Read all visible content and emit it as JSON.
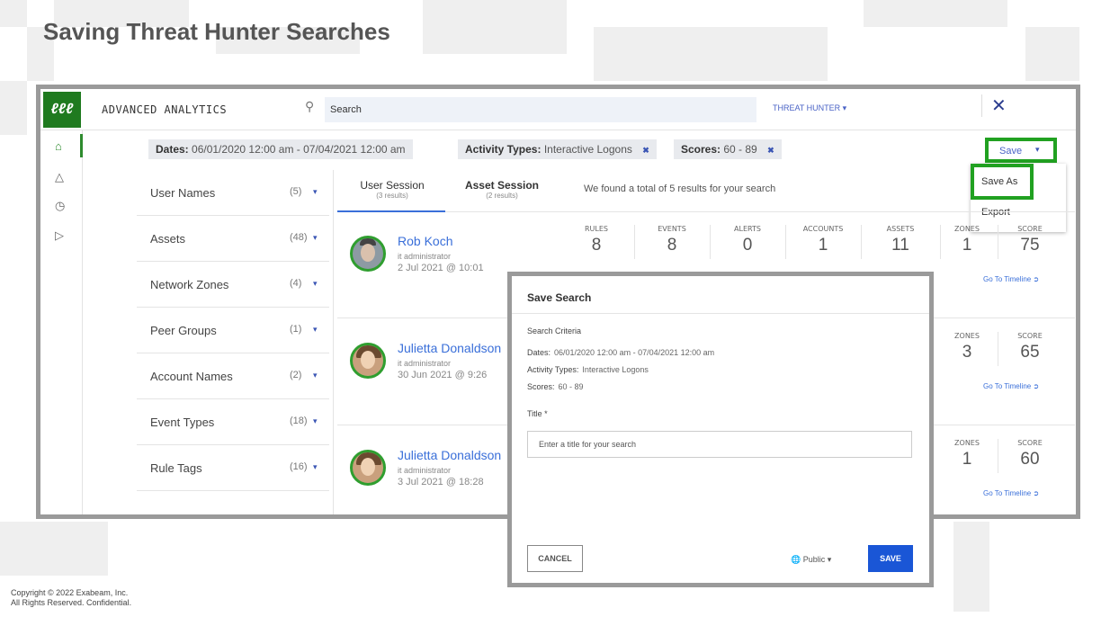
{
  "slide": {
    "title": "Saving Threat Hunter Searches",
    "copyright_line1": "Copyright © 2022 Exabeam, Inc.",
    "copyright_line2": "All Rights Reserved. Confidential."
  },
  "topbar": {
    "logo_text": "ℓℓℓ",
    "app_title": "ADVANCED ANALYTICS",
    "search_placeholder": "Search",
    "threat_hunter_label": "THREAT HUNTER ▾",
    "close_glyph": "✕"
  },
  "sidenav": {
    "icons": [
      "home-icon",
      "alert-triangle-icon",
      "clock-icon",
      "play-icon"
    ],
    "glyphs": [
      "⌂",
      "△",
      "◷",
      "▷"
    ]
  },
  "filters": {
    "dates_label": "Dates:",
    "dates_value": "06/01/2020 12:00 am - 07/04/2021 12:00 am",
    "activity_label": "Activity Types:",
    "activity_value": "Interactive Logons",
    "scores_label": "Scores:",
    "scores_value": "60 - 89",
    "remove_glyph": "✖"
  },
  "save_menu": {
    "save_label": "Save",
    "caret": "▾",
    "save_as_label": "Save As",
    "export_label": "Export"
  },
  "facets": [
    {
      "label": "User Names",
      "count": "(5)"
    },
    {
      "label": "Assets",
      "count": "(48)"
    },
    {
      "label": "Network Zones",
      "count": "(4)"
    },
    {
      "label": "Peer Groups",
      "count": "(1)"
    },
    {
      "label": "Account Names",
      "count": "(2)"
    },
    {
      "label": "Event Types",
      "count": "(18)"
    },
    {
      "label": "Rule Tags",
      "count": "(16)"
    }
  ],
  "facet_caret": "▾",
  "tabs": [
    {
      "label": "User Session",
      "sub": "(3 results)"
    },
    {
      "label": "Asset Session",
      "sub": "(2 results)"
    }
  ],
  "results_summary": "We found a total of 5 results for your search",
  "stat_labels": {
    "rules": "RULES",
    "events": "EVENTS",
    "alerts": "ALERTS",
    "accounts": "ACCOUNTS",
    "assets": "ASSETS",
    "zones": "ZONES",
    "score": "SCORE"
  },
  "goto_label": "Go To Timeline ➲",
  "results": [
    {
      "name": "Rob Koch",
      "role": "it administrator",
      "date": "2 Jul 2021 @ 10:01",
      "rules": "8",
      "events": "8",
      "alerts": "0",
      "accounts": "1",
      "assets": "11",
      "zones": "1",
      "score": "75"
    },
    {
      "name": "Julietta Donaldson",
      "role": "it administrator",
      "date": "30 Jun 2021 @ 9:26",
      "zones": "3",
      "score": "65"
    },
    {
      "name": "Julietta Donaldson",
      "role": "it administrator",
      "date": "3 Jul 2021 @ 18:28",
      "zones": "1",
      "score": "60"
    }
  ],
  "modal": {
    "title": "Save Search",
    "criteria_heading": "Search Criteria",
    "dates_label": "Dates:",
    "dates_value": "06/01/2020 12:00 am - 07/04/2021 12:00 am",
    "activity_label": "Activity Types:",
    "activity_value": "Interactive Logons",
    "scores_label": "Scores:",
    "scores_value": "60 - 89",
    "title_field_label": "Title *",
    "title_placeholder": "Enter a title for your search",
    "cancel_label": "CANCEL",
    "visibility_label": "🌐 Public ▾",
    "save_label": "SAVE"
  },
  "colors": {
    "brand_green": "#1f7a1f",
    "highlight_green": "#21a121",
    "link_blue": "#3a6fd9",
    "save_blue": "#1a56d6",
    "frame_gray": "#9a9a9a"
  }
}
